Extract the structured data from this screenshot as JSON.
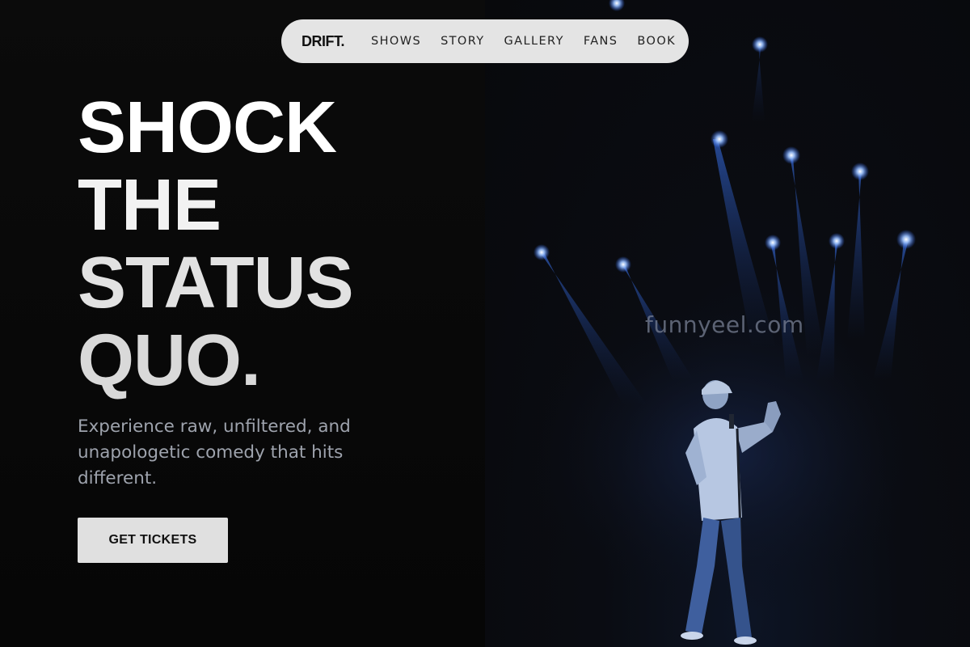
{
  "nav": {
    "brand": "DRIFT.",
    "links": [
      "SHOWS",
      "STORY",
      "GALLERY",
      "FANS",
      "BOOK"
    ]
  },
  "hero": {
    "title_lines": [
      "SHOCK",
      "THE",
      "STATUS",
      "QUO."
    ],
    "subtitle": "Experience raw, unfiltered, and unapologetic comedy that hits different.",
    "cta_label": "GET TICKETS"
  },
  "watermark": "funnyeel.com",
  "images": {
    "hero_photo": "comedian-on-stage-with-microphone-under-blue-stage-lights"
  },
  "colors": {
    "background": "#070707",
    "nav_pill": "#e4e4e4",
    "cta_background": "#e0e0e0",
    "subtitle_text": "#9ea3ad",
    "stage_light": "#6fa3ff"
  }
}
